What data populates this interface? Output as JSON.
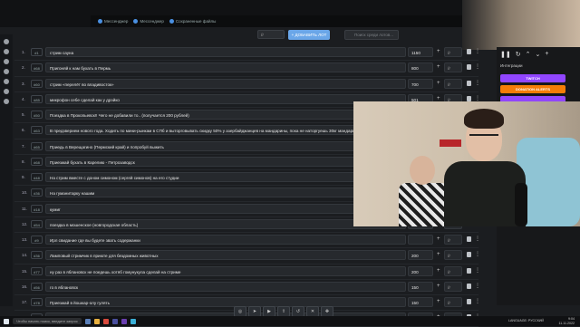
{
  "browser": {
    "tabs": [
      {
        "label": "Мессенджер"
      },
      {
        "label": "Мессенджер"
      },
      {
        "label": "Сохраненные файлы"
      }
    ]
  },
  "controls": {
    "amount_placeholder": "₽",
    "add_button": "+ ДОБАВИТЬ ЛОТ",
    "search_placeholder": "Поиск среди лотов..."
  },
  "lots": [
    {
      "n": "1.",
      "id": "#1",
      "title": "стрим сауна",
      "amount": "1150",
      "currency": "₽"
    },
    {
      "n": "2.",
      "id": "#68",
      "title": "Пригоняй к нам бухать в Пермь",
      "amount": "800",
      "currency": "₽"
    },
    {
      "n": "3.",
      "id": "#60",
      "title": "стрим «перелёт во владивосток»",
      "amount": "700",
      "currency": "₽"
    },
    {
      "n": "4.",
      "id": "#85",
      "title": "микрофон себе сделай как у дрэйко",
      "amount": "501",
      "currency": "₽"
    },
    {
      "n": "5.",
      "id": "#50",
      "title": "Поездка в Прокопьевск!! Чего не добавили то.. (получается 200 рублей)",
      "amount": "",
      "currency": "₽"
    },
    {
      "n": "6.",
      "id": "#63",
      "title": "В предзверием нового года. Ходить по мини-рынкам в СПб и выторговывать скидку 50% у азербайджанцев на мандарины, пока не наторгуешь 30кг мандарин",
      "amount": "",
      "currency": "₽"
    },
    {
      "n": "7.",
      "id": "#65",
      "title": "Приедь в Верещагино (Пермский край) и попробуй выжить",
      "amount": "",
      "currency": "₽"
    },
    {
      "n": "8.",
      "id": "#68",
      "title": "Приезжай бухать в Карелию - Петрозаводск",
      "amount": "",
      "currency": "₽"
    },
    {
      "n": "9.",
      "id": "#48",
      "title": "На стрим вместе с доном симоном (сергей симонов) на его студии",
      "amount": "",
      "currency": "₽"
    },
    {
      "n": "10.",
      "id": "#36",
      "title": "На гуманитарку нашим",
      "amount": "",
      "currency": "₽"
    },
    {
      "n": "11.",
      "id": "#18",
      "title": "кумиг",
      "amount": "",
      "currency": "₽"
    },
    {
      "n": "12.",
      "id": "#54",
      "title": "поездка в мошенское (новгородская область)",
      "amount": "",
      "currency": "₽"
    },
    {
      "n": "13.",
      "id": "#9",
      "title": "Ирл свидание где вы будете звать содержанки",
      "amount": "",
      "currency": "₽"
    },
    {
      "n": "14.",
      "id": "#36",
      "title": "Ламповый стримчик в приюте для бездомных животных",
      "amount": "200",
      "currency": "₽"
    },
    {
      "n": "15.",
      "id": "#77",
      "title": "ну раз в яблановск не поедешь хотяб гомунукула сделай на стриме",
      "amount": "200",
      "currency": "₽"
    },
    {
      "n": "16.",
      "id": "#56",
      "title": "го в яблановск",
      "amount": "150",
      "currency": "₽"
    },
    {
      "n": "17.",
      "id": "#78",
      "title": "Приезжай в йошкар-олу гулять",
      "amount": "150",
      "currency": "₽"
    },
    {
      "n": "18.",
      "id": "#78",
      "title": "КУРСК",
      "amount": "111",
      "currency": "₽"
    }
  ],
  "side_panel": {
    "heading": "Интеграции",
    "buttons": [
      {
        "label": "TWITCH",
        "color": "#9146ff"
      },
      {
        "label": "DONATION ALERTS",
        "color": "#f57d07"
      },
      {
        "label": "",
        "color": "#9146ff"
      }
    ]
  },
  "taskbar": {
    "search_text": "Чтобы начать поиск, введите запрос",
    "language": "LANGUAGE: РУССКИЙ",
    "time": "9:04",
    "date": "11.11.2022"
  },
  "colors": {
    "accent": "#6aa6e8",
    "background": "#1b1d20"
  }
}
